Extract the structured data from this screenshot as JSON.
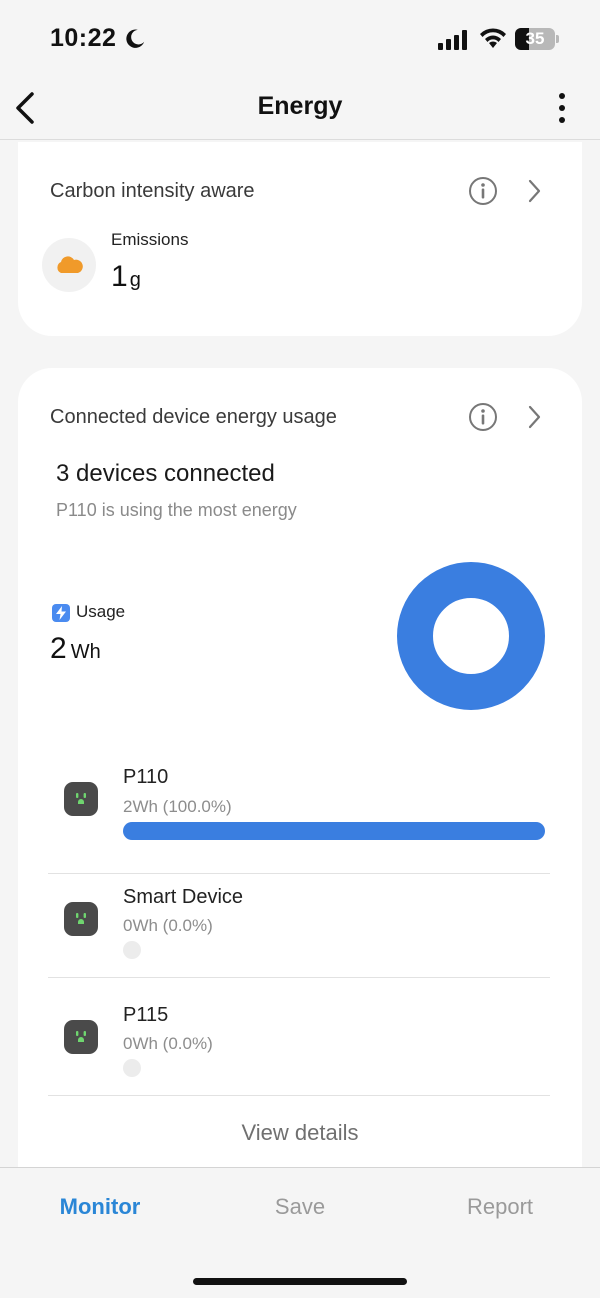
{
  "status_bar": {
    "time": "10:22",
    "battery_level": "35",
    "icons": [
      "moon-icon",
      "signal-icon",
      "wifi-icon",
      "battery-icon"
    ]
  },
  "header": {
    "title": "Energy",
    "back_icon": "chevron-left-icon",
    "menu_icon": "more-vertical-icon"
  },
  "carbon_card": {
    "title": "Carbon intensity aware",
    "emissions_label": "Emissions",
    "emissions_value": "1",
    "emissions_unit": "g",
    "icon": "cloud-icon",
    "icon_color": "#f09a2a"
  },
  "energy_card": {
    "title": "Connected device energy usage",
    "devices_connected": "3 devices connected",
    "top_device_note": "P110 is using the most energy",
    "usage_label": "Usage",
    "usage_value": "2",
    "usage_unit": "Wh",
    "donut_color": "#3a7ee0",
    "devices": [
      {
        "name": "P110",
        "usage": "2Wh (100.0%)",
        "share": 1.0
      },
      {
        "name": "Smart Device",
        "usage": "0Wh (0.0%)",
        "share": 0.0
      },
      {
        "name": "P115",
        "usage": "0Wh (0.0%)",
        "share": 0.0
      }
    ],
    "view_details": "View details"
  },
  "tabs": [
    {
      "label": "Monitor",
      "active": true
    },
    {
      "label": "Save",
      "active": false
    },
    {
      "label": "Report",
      "active": false
    }
  ],
  "colors": {
    "accent": "#2a86d6",
    "bar": "#3a7ee0",
    "plug_glyph": "#6fd56f"
  }
}
